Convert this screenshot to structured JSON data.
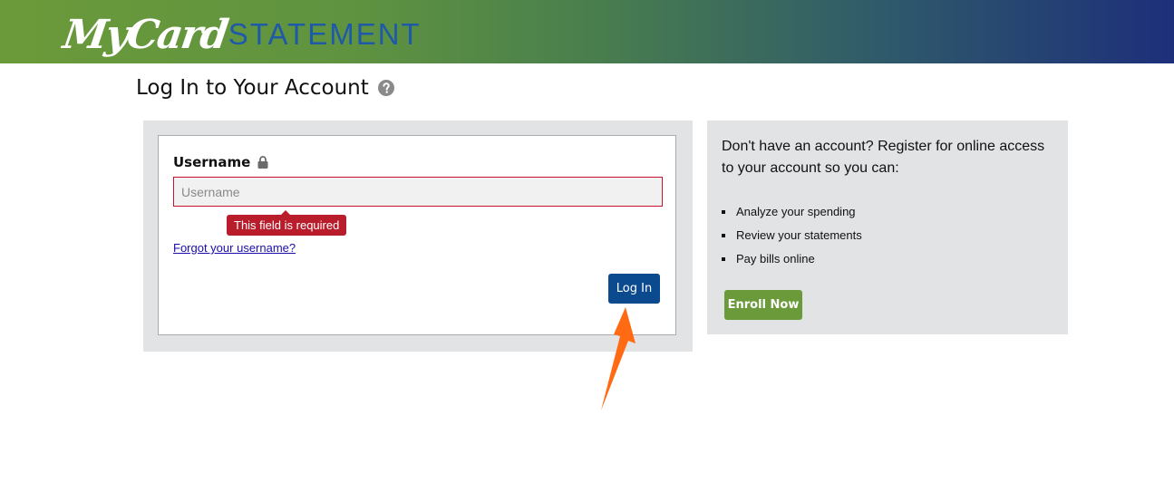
{
  "header": {
    "logo_script": "MyCard",
    "logo_word": "STATEMENT"
  },
  "page": {
    "title": "Log In to Your Account",
    "help_icon": "question-circle-icon"
  },
  "login_form": {
    "username_label": "Username",
    "lock_icon": "lock-icon",
    "username_value": "",
    "username_placeholder": "Username",
    "error_message": "This field is required",
    "forgot_link": "Forgot your username?",
    "login_button": "Log In"
  },
  "register_panel": {
    "intro": "Don't have an account? Register for online access to your account so you can:",
    "benefits": [
      "Analyze your spending",
      "Review your statements",
      "Pay bills online"
    ],
    "enroll_button": "Enroll Now"
  },
  "annotation": {
    "arrow_icon": "orange-pointer-arrow-icon",
    "arrow_color": "#ff6a13"
  },
  "colors": {
    "header_green": "#6b9a3a",
    "header_navy": "#1d2f7a",
    "login_button": "#0b4a8f",
    "enroll_button": "#6b9a3a",
    "error_red": "#b91c2b",
    "panel_gray": "#e2e3e5"
  }
}
